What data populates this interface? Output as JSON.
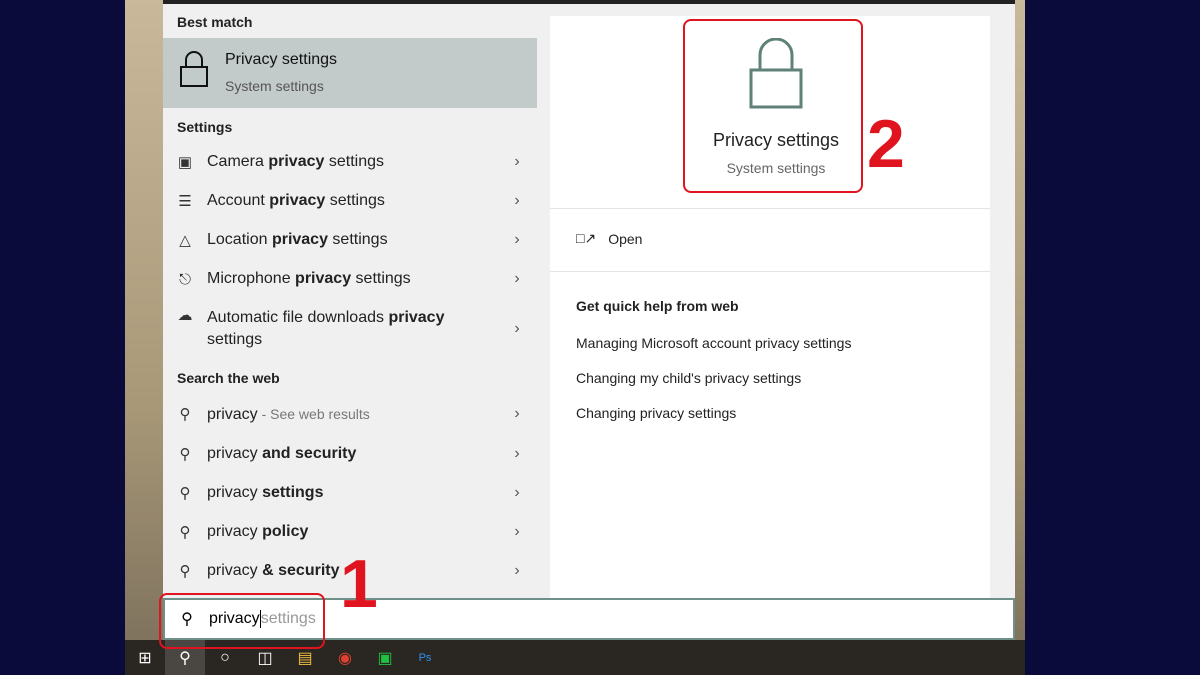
{
  "best_match": {
    "heading": "Best match",
    "title": "Privacy settings",
    "subtitle": "System settings"
  },
  "settings": {
    "heading": "Settings",
    "items": [
      {
        "icon": "camera-icon",
        "pre": "Camera ",
        "bold": "privacy",
        "post": " settings"
      },
      {
        "icon": "account-icon",
        "pre": "Account ",
        "bold": "privacy",
        "post": " settings"
      },
      {
        "icon": "location-icon",
        "pre": "Location ",
        "bold": "privacy",
        "post": " settings"
      },
      {
        "icon": "microphone-icon",
        "pre": "Microphone ",
        "bold": "privacy",
        "post": " settings"
      },
      {
        "icon": "cloud-icon",
        "pre": "Automatic file downloads ",
        "bold": "privacy",
        "post": " settings"
      }
    ]
  },
  "web": {
    "heading": "Search the web",
    "items": [
      {
        "pre": "privacy",
        "bold": "",
        "post": "",
        "hint": " - See web results"
      },
      {
        "pre": "privacy ",
        "bold": "and security",
        "post": "",
        "hint": ""
      },
      {
        "pre": "privacy ",
        "bold": "settings",
        "post": "",
        "hint": ""
      },
      {
        "pre": "privacy ",
        "bold": "policy",
        "post": "",
        "hint": ""
      },
      {
        "pre": "privacy ",
        "bold": "& security",
        "post": "",
        "hint": ""
      }
    ]
  },
  "preview": {
    "title": "Privacy settings",
    "subtitle": "System settings",
    "open_label": "Open",
    "help_heading": "Get quick help from web",
    "links": [
      "Managing Microsoft account privacy settings",
      "Changing my child's privacy settings",
      "Changing privacy settings"
    ]
  },
  "search": {
    "typed": "privacy",
    "suggestion": "settings"
  },
  "annotations": {
    "one": "1",
    "two": "2",
    "color": "#e0141e"
  },
  "colors": {
    "accent": "#5f8178",
    "highlight": "#c3cbca"
  }
}
